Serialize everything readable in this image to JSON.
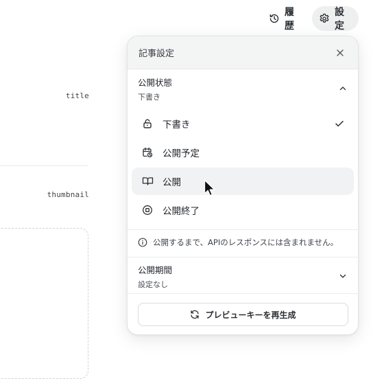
{
  "topbar": {
    "history_label": "履歴",
    "settings_label": "設定"
  },
  "form": {
    "title_label": "title",
    "thumbnail_label": "thumbnail"
  },
  "panel": {
    "title": "記事設定",
    "status": {
      "title": "公開状態",
      "current": "下書き",
      "expanded": true,
      "options": [
        {
          "label": "下書き",
          "icon": "lock-icon",
          "selected": true
        },
        {
          "label": "公開予定",
          "icon": "calendar-clock-icon",
          "selected": false
        },
        {
          "label": "公開",
          "icon": "book-open-icon",
          "selected": false,
          "hovered": true
        },
        {
          "label": "公開終了",
          "icon": "stop-circle-icon",
          "selected": false
        }
      ]
    },
    "note": "公開するまで、APIのレスポンスには含まれません。",
    "period": {
      "title": "公開期間",
      "value": "設定なし",
      "expanded": false
    },
    "preview_button": "プレビューキーを再生成"
  },
  "colors": {
    "accent_bg": "#eeefef",
    "hover_bg": "#f1f2f3",
    "text": "#1f2328"
  }
}
